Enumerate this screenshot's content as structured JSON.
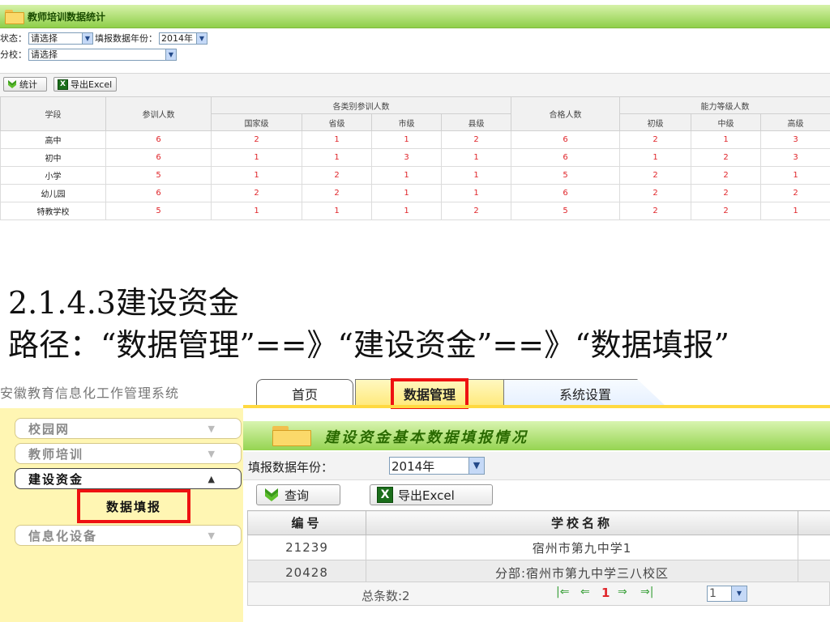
{
  "top": {
    "title": "教师培训数据统计",
    "filters": {
      "status_label": "状态：",
      "status_value": "请选择",
      "year_label": "填报数据年份：",
      "year_value": "2014年",
      "branch_label": "分校：",
      "branch_value": "请选择"
    },
    "toolbar": {
      "stats_label": "统计",
      "export_label": "导出Excel"
    },
    "table": {
      "h_stage": "学段",
      "h_trainees": "参训人数",
      "h_by_level": "各类别参训人数",
      "h_qualified": "合格人数",
      "h_ability": "能力等级人数",
      "sub_national": "国家级",
      "sub_province": "省级",
      "sub_city": "市级",
      "sub_county": "县级",
      "sub_junior": "初级",
      "sub_middle": "中级",
      "sub_senior": "高级",
      "rows": [
        {
          "stage": "高中",
          "t": "6",
          "n": "2",
          "p": "1",
          "c": "1",
          "k": "2",
          "q": "6",
          "a1": "2",
          "a2": "1",
          "a3": "3"
        },
        {
          "stage": "初中",
          "t": "6",
          "n": "1",
          "p": "1",
          "c": "3",
          "k": "1",
          "q": "6",
          "a1": "1",
          "a2": "2",
          "a3": "3"
        },
        {
          "stage": "小学",
          "t": "5",
          "n": "1",
          "p": "2",
          "c": "1",
          "k": "1",
          "q": "5",
          "a1": "2",
          "a2": "2",
          "a3": "1"
        },
        {
          "stage": "幼儿园",
          "t": "6",
          "n": "2",
          "p": "2",
          "c": "1",
          "k": "1",
          "q": "6",
          "a1": "2",
          "a2": "2",
          "a3": "2"
        },
        {
          "stage": "特教学校",
          "t": "5",
          "n": "1",
          "p": "1",
          "c": "1",
          "k": "2",
          "q": "5",
          "a1": "2",
          "a2": "2",
          "a3": "1"
        }
      ]
    }
  },
  "slide": {
    "heading": "2.1.4.3建设资金",
    "path": "路径：“数据管理”==》“建设资金”==》“数据填报”"
  },
  "bottom": {
    "system_title": "安徽教育信息化工作管理系统",
    "tabs": {
      "home": "首页",
      "data": "数据管理",
      "settings": "系统设置"
    },
    "sidebar": {
      "campus": "校园网",
      "teacher": "教师培训",
      "funds": "建设资金",
      "fill": "数据填报",
      "equip": "信息化设备"
    },
    "main_title": "建设资金基本数据填报情况",
    "year_label": "填报数据年份：",
    "year_value": "2014年",
    "query_label": "查询",
    "export_label": "导出Excel",
    "col_id": "编号",
    "col_name": "学校名称",
    "rows": [
      {
        "id": "21239",
        "name": "宿州市第九中学1"
      },
      {
        "id": "20428",
        "name": "分部:宿州市第九中学三八校区"
      }
    ],
    "pager": {
      "total": "总条数:2",
      "page": "1",
      "page_select": "1"
    },
    "colors": {
      "accent_green": "#8fcf4a",
      "highlight_red": "#ee1111",
      "tab_yellow": "#ffd941"
    }
  }
}
